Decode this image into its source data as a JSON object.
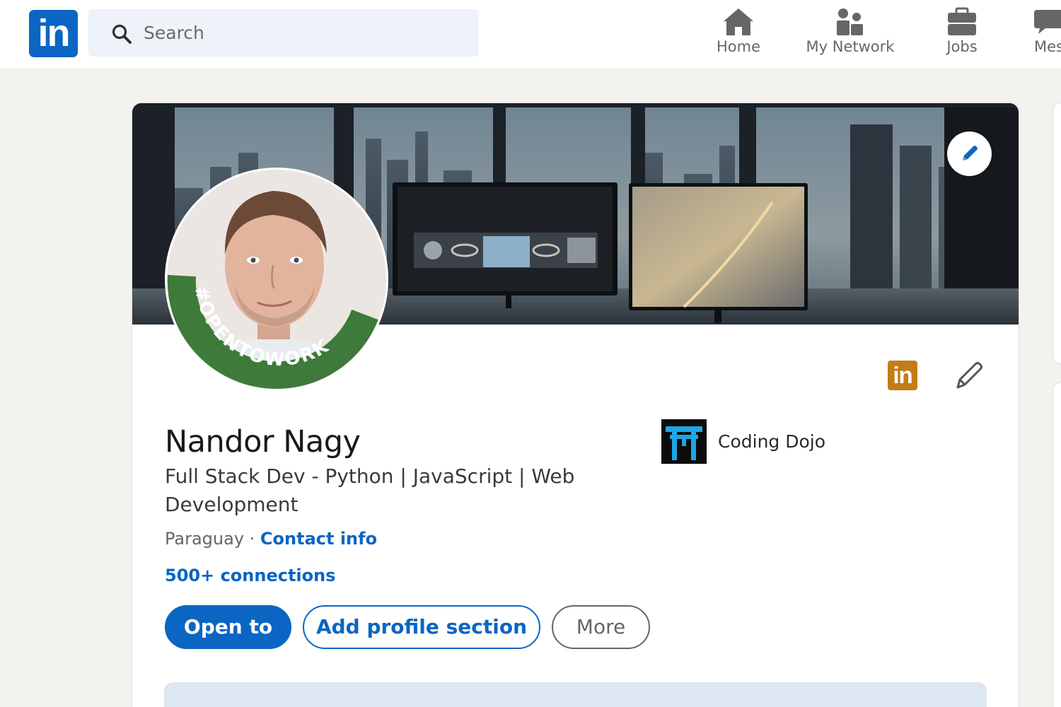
{
  "topbar": {
    "logo_text": "in",
    "search_placeholder": "Search",
    "nav": [
      {
        "label": "Home",
        "icon": "home-icon"
      },
      {
        "label": "My Network",
        "icon": "network-icon"
      },
      {
        "label": "Jobs",
        "icon": "briefcase-icon"
      },
      {
        "label": "Mes",
        "icon": "messaging-icon"
      }
    ]
  },
  "profile": {
    "name": "Nandor Nagy",
    "headline": "Full Stack Dev - Python | JavaScript | Web Development",
    "location": "Paraguay",
    "separator": " · ",
    "contact_info_label": "Contact info",
    "connections": "500+ connections",
    "open_to_work_frame": "#OPENTOWORK",
    "badge_text": "in",
    "company": {
      "name": "Coding Dojo"
    }
  },
  "actions": {
    "open_to": "Open to",
    "add_section": "Add profile section",
    "more": "More"
  },
  "colors": {
    "brand_blue": "#0a66c2",
    "open_to_work_green": "#3e7a3a",
    "premium_gold": "#c37d16",
    "page_bg": "#f4f2ee"
  }
}
